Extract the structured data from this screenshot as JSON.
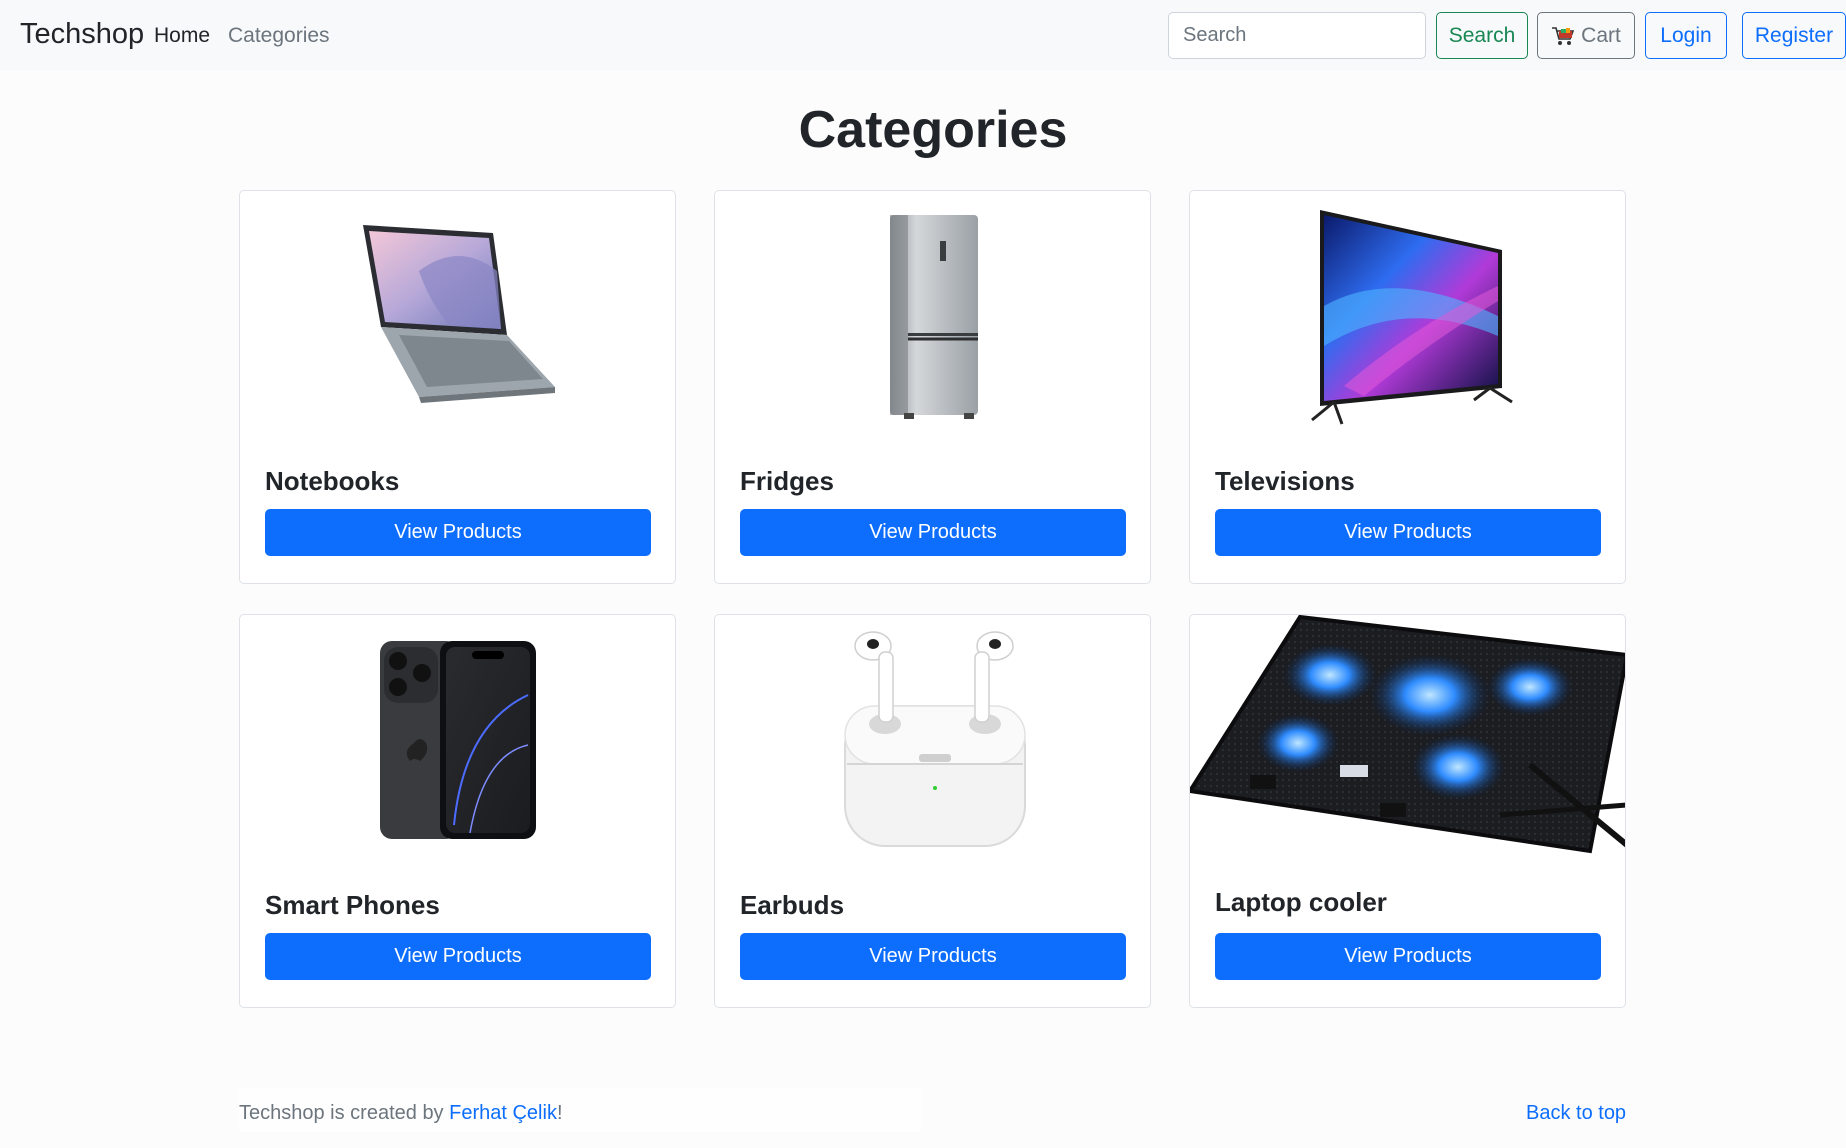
{
  "navbar": {
    "brand": "Techshop",
    "links": [
      "Home",
      "Categories"
    ],
    "search_placeholder": "Search",
    "search_button": "Search",
    "cart_button": "Cart",
    "login_button": "Login",
    "register_button": "Register"
  },
  "page_title": "Categories",
  "categories": [
    {
      "name": "Notebooks",
      "button": "View Products",
      "icon": "laptop-image"
    },
    {
      "name": "Fridges",
      "button": "View Products",
      "icon": "fridge-image"
    },
    {
      "name": "Televisions",
      "button": "View Products",
      "icon": "television-image"
    },
    {
      "name": "Smart Phones",
      "button": "View Products",
      "icon": "smartphone-image"
    },
    {
      "name": "Earbuds",
      "button": "View Products",
      "icon": "earbuds-image"
    },
    {
      "name": "Laptop cooler",
      "button": "View Products",
      "icon": "laptop-cooler-image"
    }
  ],
  "footer": {
    "prefix": "Techshop is created by ",
    "author": "Ferhat Çelik",
    "suffix": "!",
    "back_to_top": "Back to top"
  },
  "colors": {
    "primary": "#0d6efd",
    "success": "#198754",
    "secondary": "#6c757d",
    "navbar_bg": "#f8f9fa"
  }
}
